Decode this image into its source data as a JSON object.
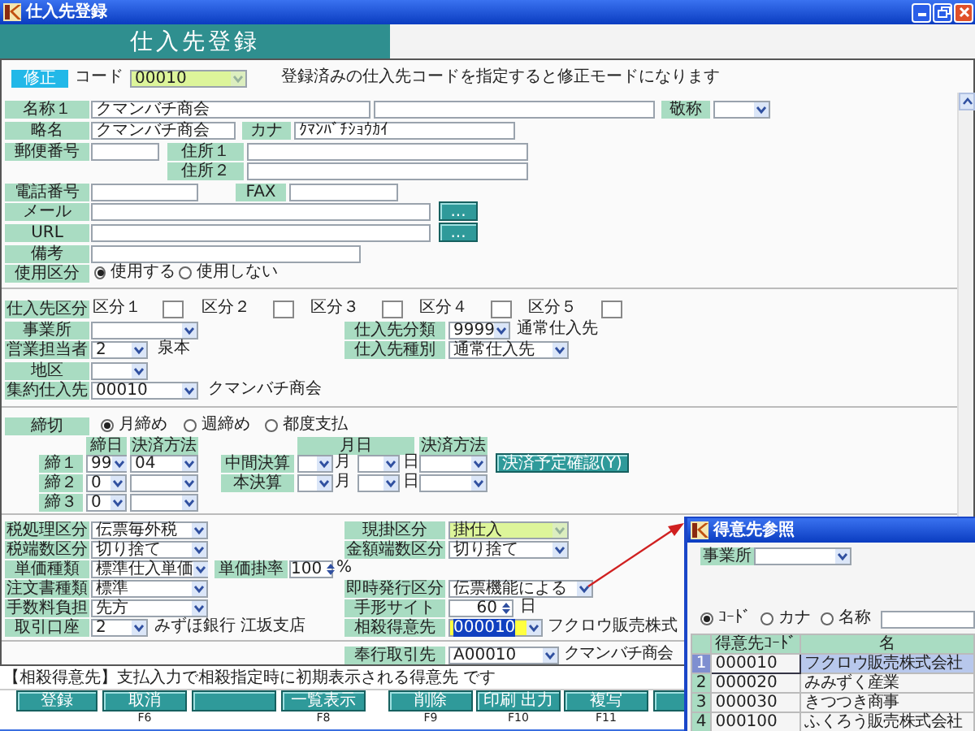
{
  "window": {
    "title": "仕入先登録"
  },
  "header": {
    "title": "仕入先登録"
  },
  "form": {
    "sections": [
      {
        "rows": [
          [
            {
              "kind": "badge",
              "text": "修正"
            },
            {
              "kind": "text",
              "text": "コード"
            },
            {
              "kind": "select",
              "value": "00010",
              "disabled": true
            },
            {
              "kind": "text",
              "text": "登録済みの仕入先コードを指定すると修正モードになります"
            }
          ]
        ]
      },
      {
        "rows": [
          [
            {
              "kind": "label",
              "text": "名称１"
            },
            {
              "kind": "input",
              "value": "クマンバチ商会"
            },
            {
              "kind": "input"
            },
            {
              "kind": "label",
              "text": "敬称"
            },
            {
              "kind": "select"
            }
          ],
          [
            {
              "kind": "label",
              "text": "略名"
            },
            {
              "kind": "input",
              "value": "クマンバチ商会"
            },
            {
              "kind": "label",
              "text": "カナ"
            },
            {
              "kind": "input",
              "value": "ｸﾏﾝﾊﾞﾁｼｮｳｶｲ"
            }
          ],
          [
            {
              "kind": "label",
              "text": "郵便番号"
            },
            {
              "kind": "input"
            },
            {
              "kind": "label",
              "text": "住所１"
            },
            {
              "kind": "input"
            }
          ],
          [
            {
              "kind": "gap"
            },
            {
              "kind": "label",
              "text": "住所２"
            },
            {
              "kind": "input"
            }
          ],
          [
            {
              "kind": "label",
              "text": "電話番号"
            },
            {
              "kind": "input"
            },
            {
              "kind": "label",
              "text": "FAX"
            },
            {
              "kind": "input"
            }
          ],
          [
            {
              "kind": "label",
              "text": "メール"
            },
            {
              "kind": "input"
            },
            {
              "kind": "button",
              "text": "..."
            }
          ],
          [
            {
              "kind": "label",
              "text": "URL"
            },
            {
              "kind": "input"
            },
            {
              "kind": "button",
              "text": "..."
            }
          ],
          [
            {
              "kind": "label",
              "text": "備考"
            },
            {
              "kind": "input"
            }
          ],
          [
            {
              "kind": "label",
              "text": "使用区分"
            },
            {
              "kind": "radio",
              "text": "使用する",
              "selected": true
            },
            {
              "kind": "radio",
              "text": "使用しない",
              "selected": false
            }
          ]
        ]
      },
      {
        "rows": [
          [
            {
              "kind": "label",
              "text": "仕入先区分"
            },
            {
              "kind": "text",
              "text": "区分１"
            },
            {
              "kind": "checkbox",
              "checked": false
            },
            {
              "kind": "text",
              "text": "区分２"
            },
            {
              "kind": "checkbox",
              "checked": false
            },
            {
              "kind": "text",
              "text": "区分３"
            },
            {
              "kind": "checkbox",
              "checked": false
            },
            {
              "kind": "text",
              "text": "区分４"
            },
            {
              "kind": "checkbox",
              "checked": false
            },
            {
              "kind": "text",
              "text": "区分５"
            },
            {
              "kind": "checkbox",
              "checked": false
            }
          ]
        ]
      },
      {
        "rows": [
          [
            {
              "kind": "label",
              "text": "事業所"
            },
            {
              "kind": "select"
            },
            {
              "kind": "gap"
            },
            {
              "kind": "label",
              "text": "仕入先分類"
            },
            {
              "kind": "select",
              "value": "9999"
            },
            {
              "kind": "text",
              "text": "通常仕入先"
            }
          ],
          [
            {
              "kind": "label",
              "text": "営業担当者"
            },
            {
              "kind": "select",
              "value": "2"
            },
            {
              "kind": "text",
              "text": "泉本"
            },
            {
              "kind": "label",
              "text": "仕入先種別"
            },
            {
              "kind": "select",
              "value": "通常仕入先"
            }
          ],
          [
            {
              "kind": "label",
              "text": "地区"
            },
            {
              "kind": "select"
            }
          ],
          [
            {
              "kind": "label",
              "text": "集約仕入先"
            },
            {
              "kind": "select",
              "value": "00010"
            },
            {
              "kind": "text",
              "text": "クマンバチ商会"
            }
          ]
        ]
      },
      {
        "rows": [
          [
            {
              "kind": "label",
              "text": "締切"
            },
            {
              "kind": "radio",
              "text": "月締め",
              "selected": true
            },
            {
              "kind": "radio",
              "text": "週締め",
              "selected": false
            },
            {
              "kind": "radio",
              "text": "都度支払",
              "selected": false
            }
          ]
        ]
      },
      {
        "rows": [
          [
            {
              "kind": "gap"
            },
            {
              "kind": "heading",
              "text": "締日"
            },
            {
              "kind": "heading",
              "text": "決済方法"
            },
            {
              "kind": "gap"
            },
            {
              "kind": "heading",
              "text": "月日"
            },
            {
              "kind": "gap"
            },
            {
              "kind": "gap"
            },
            {
              "kind": "gap"
            },
            {
              "kind": "heading",
              "text": "決済方法"
            }
          ],
          [
            {
              "kind": "label",
              "text": "締１"
            },
            {
              "kind": "select",
              "value": "99"
            },
            {
              "kind": "select",
              "value": "04"
            },
            {
              "kind": "label",
              "text": "中間決算"
            },
            {
              "kind": "select"
            },
            {
              "kind": "text",
              "text": "月"
            },
            {
              "kind": "select"
            },
            {
              "kind": "text",
              "text": "日"
            },
            {
              "kind": "select"
            },
            {
              "kind": "button",
              "text": "決済予定確認(Y)"
            }
          ],
          [
            {
              "kind": "label",
              "text": "締２"
            },
            {
              "kind": "select",
              "value": "0"
            },
            {
              "kind": "select"
            },
            {
              "kind": "label",
              "text": "本決算"
            },
            {
              "kind": "select"
            },
            {
              "kind": "text",
              "text": "月"
            },
            {
              "kind": "select"
            },
            {
              "kind": "text",
              "text": "日"
            },
            {
              "kind": "select"
            }
          ],
          [
            {
              "kind": "label",
              "text": "締３"
            },
            {
              "kind": "select",
              "value": "0"
            },
            {
              "kind": "select"
            }
          ]
        ]
      },
      {
        "rows": [
          [
            {
              "kind": "label",
              "text": "税処理区分"
            },
            {
              "kind": "select",
              "value": "伝票毎外税"
            },
            {
              "kind": "gap"
            },
            {
              "kind": "gap"
            },
            {
              "kind": "label",
              "text": "現掛区分"
            },
            {
              "kind": "select",
              "value": "掛仕入",
              "disabled": true
            }
          ],
          [
            {
              "kind": "label",
              "text": "税端数区分"
            },
            {
              "kind": "select",
              "value": "切り捨て"
            },
            {
              "kind": "gap"
            },
            {
              "kind": "gap"
            },
            {
              "kind": "label",
              "text": "金額端数区分"
            },
            {
              "kind": "select",
              "value": "切り捨て"
            }
          ],
          [
            {
              "kind": "label",
              "text": "単価種類"
            },
            {
              "kind": "select",
              "value": "標準仕入単価"
            },
            {
              "kind": "label",
              "text": "単価掛率"
            },
            {
              "kind": "spin",
              "value": "100"
            },
            {
              "kind": "text",
              "text": "%"
            }
          ],
          [
            {
              "kind": "label",
              "text": "注文書種類"
            },
            {
              "kind": "select",
              "value": "標準"
            },
            {
              "kind": "gap"
            },
            {
              "kind": "gap"
            },
            {
              "kind": "label",
              "text": "即時発行区分"
            },
            {
              "kind": "select",
              "value": "伝票機能による"
            }
          ],
          [
            {
              "kind": "label",
              "text": "手数料負担"
            },
            {
              "kind": "select",
              "value": "先方"
            },
            {
              "kind": "gap"
            },
            {
              "kind": "gap"
            },
            {
              "kind": "label",
              "text": "手形サイト"
            },
            {
              "kind": "spin",
              "value": "60"
            },
            {
              "kind": "text",
              "text": "日"
            }
          ],
          [
            {
              "kind": "label",
              "text": "取引口座"
            },
            {
              "kind": "select",
              "value": "2"
            },
            {
              "kind": "text",
              "text": "みずほ銀行"
            },
            {
              "kind": "text",
              "text": "江坂支店"
            },
            {
              "kind": "label",
              "text": "相殺得意先"
            },
            {
              "kind": "select",
              "value": "000010",
              "focused": true
            },
            {
              "kind": "text",
              "text": "フクロウ販売株式"
            }
          ]
        ]
      },
      {
        "rows": [
          [
            {
              "kind": "label",
              "text": "奉行取引先"
            },
            {
              "kind": "select",
              "value": "A00010"
            },
            {
              "kind": "text",
              "text": "クマンバチ商会"
            }
          ]
        ]
      }
    ]
  },
  "message": "【相殺得意先】支払入力で相殺指定時に初期表示される得意先 です",
  "function_keys": [
    {
      "kind": "key",
      "label": "登録"
    },
    {
      "kind": "key",
      "label": "取消",
      "fkey": "F6"
    },
    {
      "kind": "empty"
    },
    {
      "kind": "key",
      "label": "一覧表示",
      "fkey": "F8"
    },
    {
      "kind": "key",
      "label": "削除",
      "fkey": "F9"
    },
    {
      "kind": "key",
      "label": "印刷 出力",
      "fkey": "F10"
    },
    {
      "kind": "key",
      "label": "複写",
      "fkey": "F11"
    },
    {
      "kind": "empty"
    }
  ],
  "lookup_window": {
    "title": "得意先参照",
    "office_label": "事業所",
    "search_modes": [
      {
        "label": "ｺｰﾄﾞ",
        "selected": true
      },
      {
        "label": "カナ",
        "selected": false
      },
      {
        "label": "名称",
        "selected": false
      }
    ],
    "columns": [
      "得意先ｺｰﾄﾞ",
      "名"
    ],
    "rows": [
      {
        "no": "1",
        "code": "000010",
        "name": "フクロウ販売株式会社",
        "selected": true
      },
      {
        "no": "2",
        "code": "000020",
        "name": "みみずく産業",
        "selected": false
      },
      {
        "no": "3",
        "code": "000030",
        "name": "きつつき商事",
        "selected": false
      },
      {
        "no": "4",
        "code": "000100",
        "name": "ふくろう販売株式会社",
        "selected": false
      }
    ]
  }
}
